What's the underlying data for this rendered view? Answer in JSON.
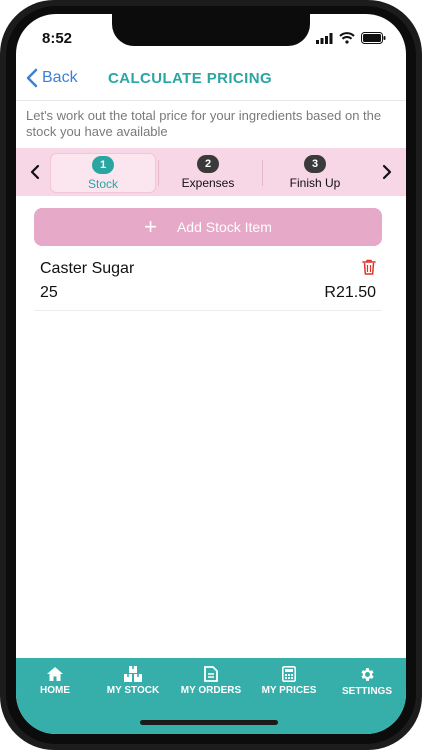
{
  "status": {
    "time": "8:52"
  },
  "nav": {
    "back_label": "Back",
    "title": "CALCULATE PRICING"
  },
  "intro_text": "Let's work out the total price for your ingredients based on the stock you have available",
  "steps": [
    {
      "number": "1",
      "label": "Stock",
      "active": true
    },
    {
      "number": "2",
      "label": "Expenses",
      "active": false
    },
    {
      "number": "3",
      "label": "Finish Up",
      "active": false
    }
  ],
  "stepper_arrows": {
    "left_icon": "chevron-left-icon",
    "right_icon": "chevron-right-icon"
  },
  "add_button": {
    "icon": "plus-icon",
    "label": "Add Stock Item"
  },
  "stock_items": [
    {
      "name": "Caster Sugar",
      "quantity": "25",
      "price": "R21.50"
    }
  ],
  "tabs": [
    {
      "label": "HOME",
      "icon": "home-icon"
    },
    {
      "label": "MY STOCK",
      "icon": "boxes-icon"
    },
    {
      "label": "MY ORDERS",
      "icon": "document-icon"
    },
    {
      "label": "MY PRICES",
      "icon": "calculator-icon"
    },
    {
      "label": "SETTINGS",
      "icon": "gear-icon"
    }
  ],
  "colors": {
    "accent": "#2aa6a2",
    "tabbar": "#36aea9",
    "stepper_bg": "#f7d7e5",
    "add_button": "#e6a9c7",
    "link": "#3b82d6",
    "delete": "#e0312b"
  }
}
